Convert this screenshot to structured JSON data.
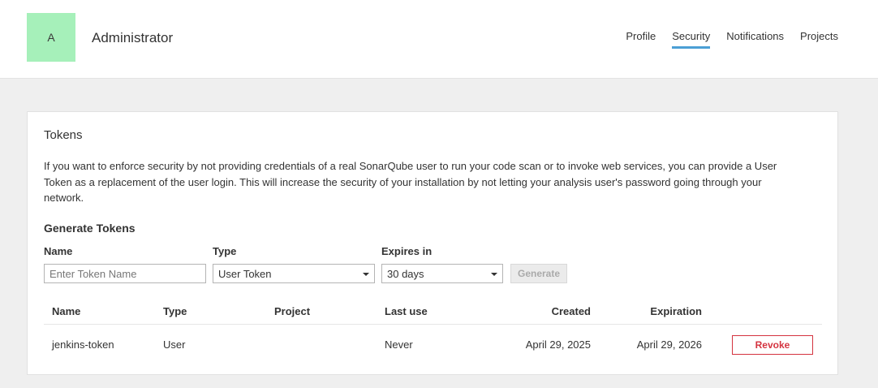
{
  "header": {
    "avatar_letter": "A",
    "user_name": "Administrator",
    "nav": [
      {
        "label": "Profile"
      },
      {
        "label": "Security"
      },
      {
        "label": "Notifications"
      },
      {
        "label": "Projects"
      }
    ],
    "active_tab": "Security",
    "accent_color": "#4b9fd5",
    "avatar_color": "#a6f0ba"
  },
  "tokens": {
    "title": "Tokens",
    "description": "If you want to enforce security by not providing credentials of a real SonarQube user to run your code scan or to invoke web services, you can provide a User Token as a replacement of the user login. This will increase the security of your installation by not letting your analysis user's password going through your network.",
    "generate": {
      "title": "Generate Tokens",
      "name_label": "Name",
      "name_placeholder": "Enter Token Name",
      "type_label": "Type",
      "type_value": "User Token",
      "expires_label": "Expires in",
      "expires_value": "30 days",
      "button": "Generate"
    },
    "table": {
      "headers": [
        "Name",
        "Type",
        "Project",
        "Last use",
        "Created",
        "Expiration"
      ],
      "rows": [
        {
          "name": "jenkins-token",
          "type": "User",
          "project": "",
          "last_use": "Never",
          "created": "April 29, 2025",
          "expiration": "April 29, 2026",
          "action": "Revoke"
        }
      ]
    },
    "danger_color": "#d4333f"
  }
}
